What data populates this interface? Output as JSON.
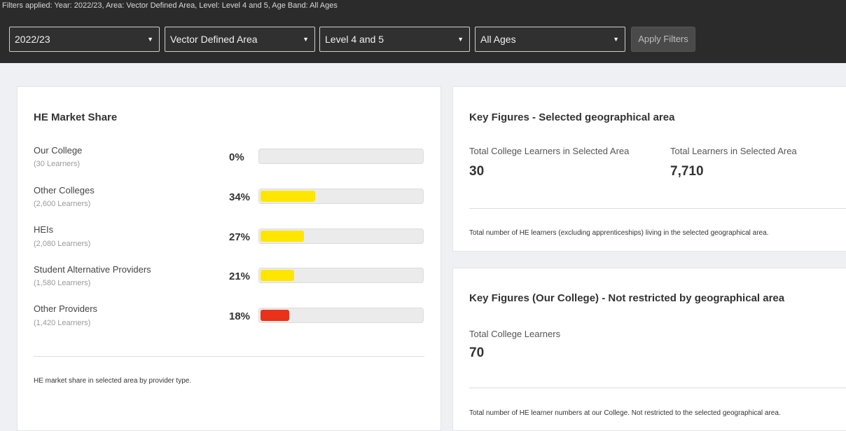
{
  "filters": {
    "applied_text": "Filters applied:  Year: 2022/23, Area: Vector Defined Area, Level: Level 4 and 5, Age Band: All Ages",
    "year": "2022/23",
    "area": "Vector Defined Area",
    "level": "Level 4 and 5",
    "age_band": "All Ages",
    "apply_label": "Apply Filters",
    "caret": "▼"
  },
  "market_share": {
    "title": "HE Market Share",
    "rows": [
      {
        "label": "Our College",
        "learners": "(30 Learners)",
        "pct": "0%",
        "value": 0,
        "color": "#ffe600"
      },
      {
        "label": "Other Colleges",
        "learners": "(2,600 Learners)",
        "pct": "34%",
        "value": 34,
        "color": "#ffe600"
      },
      {
        "label": "HEIs",
        "learners": "(2,080 Learners)",
        "pct": "27%",
        "value": 27,
        "color": "#ffe600"
      },
      {
        "label": "Student Alternative Providers",
        "learners": "(1,580 Learners)",
        "pct": "21%",
        "value": 21,
        "color": "#ffe600"
      },
      {
        "label": "Other Providers",
        "learners": "(1,420 Learners)",
        "pct": "18%",
        "value": 18,
        "color": "#e8321a"
      }
    ],
    "footnote": "HE market share in selected area by provider type."
  },
  "key_figures_area": {
    "title": "Key Figures - Selected geographical area",
    "college_learners_label": "Total College Learners in Selected Area",
    "college_learners_value": "30",
    "total_learners_label": "Total Learners in Selected Area",
    "total_learners_value": "7,710",
    "footnote": "Total number of HE learners (excluding apprenticeships) living in the selected geographical area."
  },
  "key_figures_college": {
    "title": "Key Figures (Our College) - Not restricted by geographical area",
    "college_learners_label": "Total College Learners",
    "college_learners_value": "70",
    "footnote": "Total number of HE learner numbers at our College. Not restricted to the selected geographical area."
  }
}
